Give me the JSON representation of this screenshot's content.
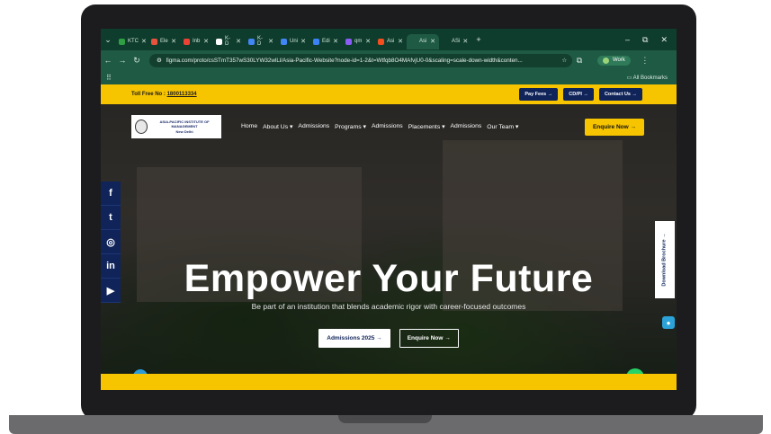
{
  "browser": {
    "tabs": [
      {
        "label": "KTC",
        "color": "#2ea043"
      },
      {
        "label": "Ele",
        "color": "#e5533d"
      },
      {
        "label": "Inb",
        "color": "#ea4335"
      },
      {
        "label": "K-D",
        "color": "#ffffff"
      },
      {
        "label": "K-D",
        "color": "#4285f4"
      },
      {
        "label": "Uni",
        "color": "#4285f4"
      },
      {
        "label": "Edi",
        "color": "#3b82f6"
      },
      {
        "label": "qm",
        "color": "#8b5cf6"
      },
      {
        "label": "Asi",
        "color": "#f24e1e"
      },
      {
        "label": "Asi",
        "color": "#1f5a44"
      },
      {
        "label": "ASi",
        "color": "#0f3d2d"
      }
    ],
    "new_tab": "+",
    "window_controls": [
      "–",
      "⧉",
      "✕"
    ],
    "url": "figma.com/proto/csSTmT357wS30LYW32wlLl/Asia-Pacific-Website?node-id=1-2&t=Wtfqb8O4MAfvjU0-0&scaling=scale-down-width&conten...",
    "profile": "Work",
    "all_bookmarks": "All Bookmarks"
  },
  "site": {
    "toll_free_label": "Toll Free No :",
    "toll_free_number": "1800113334",
    "top_buttons": [
      "Pay Fees →",
      "CD/PI →",
      "Contact Us →"
    ],
    "logo_line1": "ASIA-PACIFIC INSTITUTE OF MANAGEMENT",
    "logo_line2": "New Delhi",
    "menu": [
      "Home",
      "About Us ▾",
      "Admissions",
      "Programs ▾",
      "Admissions",
      "Placements ▾",
      "Admissions",
      "Our Team ▾"
    ],
    "enquire_top": "Enquire Now →",
    "headline": "Empower Your Future",
    "subline": "Be part of an institution that blends academic rigor with career-focused outcomes",
    "cta_admissions": "Admissions 2025 →",
    "cta_enquire": "Enquire Now →",
    "brochure": "Download Brochure →",
    "social": [
      "f",
      "t",
      "◎",
      "in",
      "▶"
    ]
  },
  "colors": {
    "accent_yellow": "#f7c400",
    "navy": "#10245a",
    "browser_green": "#1f5a44"
  }
}
